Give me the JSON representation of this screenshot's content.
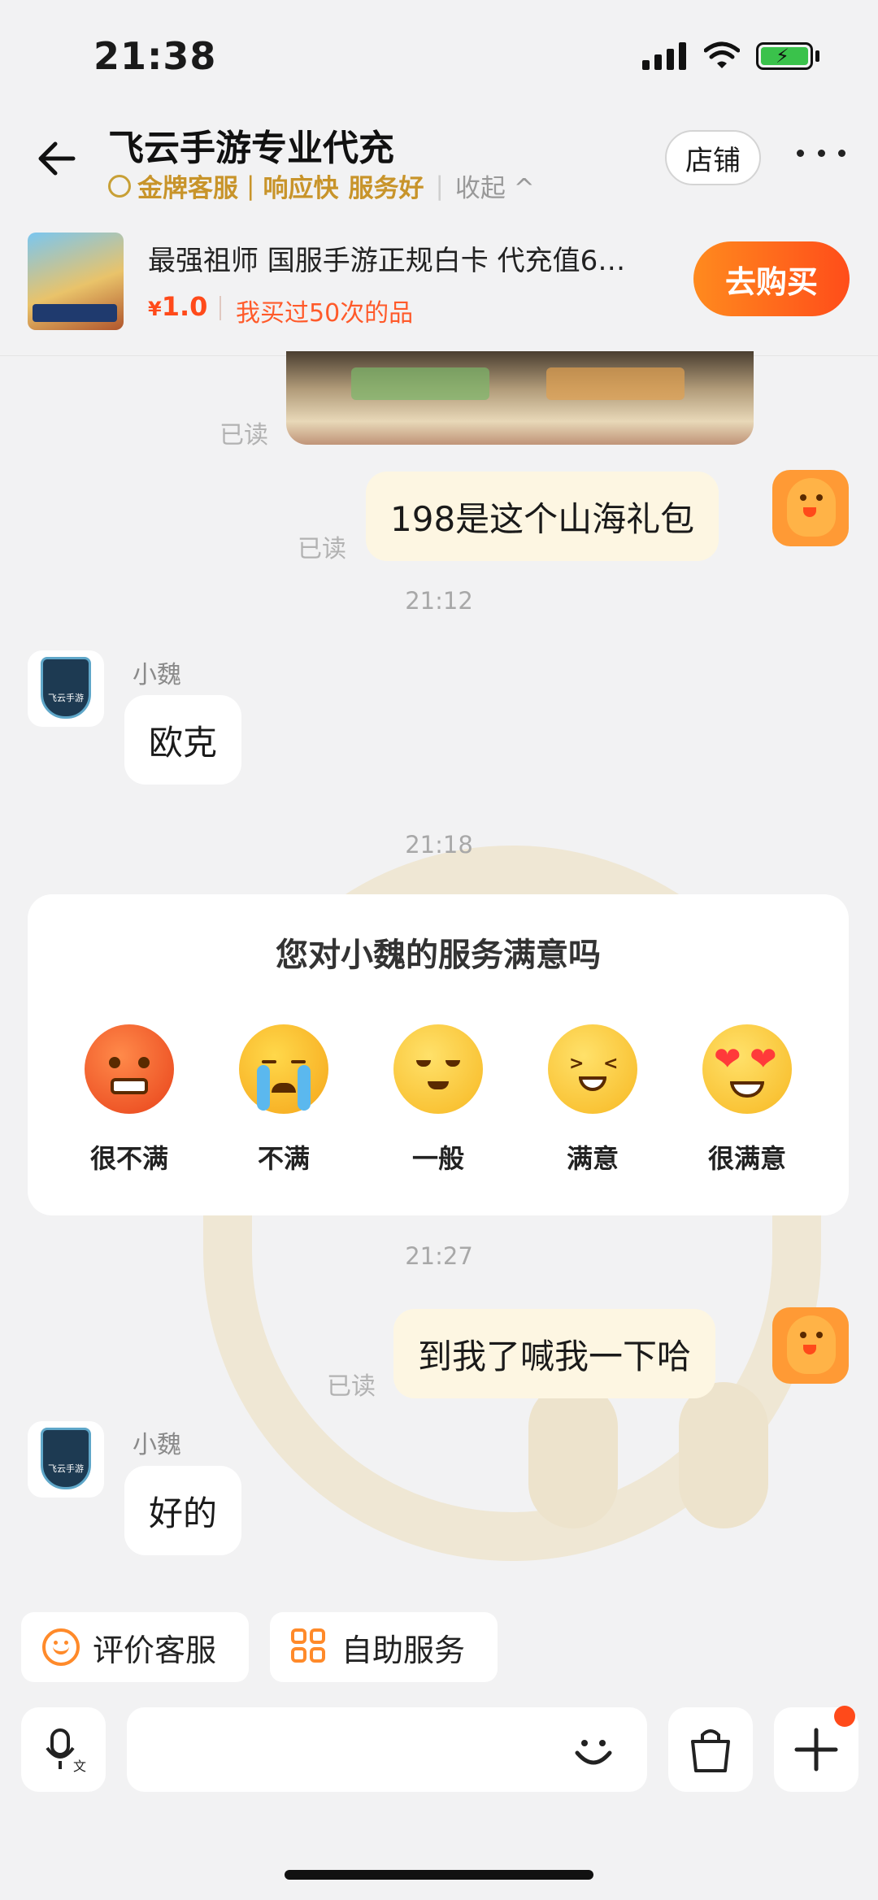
{
  "status_bar": {
    "time": "21:38"
  },
  "header": {
    "title": "飞云手游专业代充",
    "badge": "金牌客服",
    "tag1": "响应快",
    "tag2": "服务好",
    "collapse": "收起",
    "shop_button": "店铺"
  },
  "product": {
    "title": "最强祖师 国服手游正规白卡 代充值6…",
    "price_symbol": "¥",
    "price_value": "1.0",
    "bought_text": "我买过50次的品",
    "buy_button": "去购买"
  },
  "messages": [
    {
      "type": "image",
      "from": "me",
      "read": "已读"
    },
    {
      "type": "text",
      "from": "me",
      "text": "198是这个山海礼包",
      "read": "已读"
    },
    {
      "type": "timestamp",
      "text": "21:12"
    },
    {
      "type": "text",
      "from": "other",
      "sender": "小魏",
      "text": "欧克"
    },
    {
      "type": "timestamp",
      "text": "21:18"
    },
    {
      "type": "timestamp",
      "text": "21:27"
    },
    {
      "type": "text",
      "from": "me",
      "text": "到我了喊我一下哈",
      "read": "已读"
    },
    {
      "type": "text",
      "from": "other",
      "sender": "小魏",
      "text": "好的"
    }
  ],
  "rating": {
    "title": "您对小魏的服务满意吗",
    "options": [
      "很不满",
      "不满",
      "一般",
      "满意",
      "很满意"
    ]
  },
  "quick_actions": {
    "rate": "评价客服",
    "self_service": "自助服务"
  },
  "input": {
    "placeholder": ""
  },
  "icons": {
    "back": "back-arrow-icon",
    "more": "more-dots-icon",
    "voice": "voice-input-icon",
    "emoji": "emoji-icon",
    "bag": "shopping-bag-icon",
    "plus": "plus-icon"
  },
  "colors": {
    "accent": "#ff5a1f",
    "gold": "#c8942a",
    "my_bubble": "#fdf6e2"
  }
}
